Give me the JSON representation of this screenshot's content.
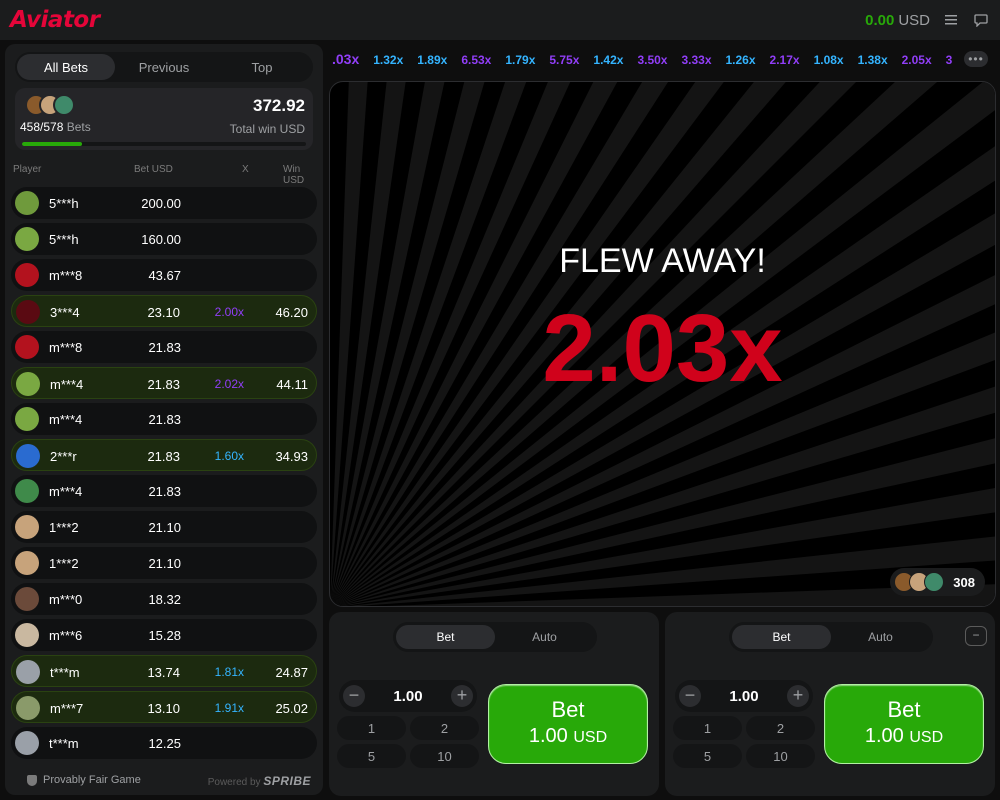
{
  "header": {
    "logo": "Aviator",
    "balance": "0.00",
    "currency": "USD"
  },
  "bets_panel": {
    "tabs": [
      "All Bets",
      "Previous",
      "Top"
    ],
    "bets_count": "458/578",
    "bets_label": "Bets",
    "total_win": "372.92",
    "total_win_label": "Total win USD",
    "progress": 0.21,
    "columns": {
      "player": "Player",
      "bet": "Bet USD",
      "x": "X",
      "win": "Win USD"
    },
    "rows": [
      {
        "player": "5***h",
        "bet": "200.00",
        "x": "",
        "win": "",
        "avatar": "#6f9a3c"
      },
      {
        "player": "5***h",
        "bet": "160.00",
        "x": "",
        "win": "",
        "avatar": "#7aa842"
      },
      {
        "player": "m***8",
        "bet": "43.67",
        "x": "",
        "win": "",
        "avatar": "#b3121e"
      },
      {
        "player": "3***4",
        "bet": "23.10",
        "x": "2.00x",
        "win": "46.20",
        "avatar": "#5a0a12"
      },
      {
        "player": "m***8",
        "bet": "21.83",
        "x": "",
        "win": "",
        "avatar": "#b3121e"
      },
      {
        "player": "m***4",
        "bet": "21.83",
        "x": "2.02x",
        "win": "44.11",
        "avatar": "#7aa842"
      },
      {
        "player": "m***4",
        "bet": "21.83",
        "x": "",
        "win": "",
        "avatar": "#7aa842"
      },
      {
        "player": "2***r",
        "bet": "21.83",
        "x": "1.60x",
        "win": "34.93",
        "avatar": "#2a6bd0"
      },
      {
        "player": "m***4",
        "bet": "21.83",
        "x": "",
        "win": "",
        "avatar": "#3f8a4a"
      },
      {
        "player": "1***2",
        "bet": "21.10",
        "x": "",
        "win": "",
        "avatar": "#c7a37b"
      },
      {
        "player": "1***2",
        "bet": "21.10",
        "x": "",
        "win": "",
        "avatar": "#c7a37b"
      },
      {
        "player": "m***0",
        "bet": "18.32",
        "x": "",
        "win": "",
        "avatar": "#6b4a3a"
      },
      {
        "player": "m***6",
        "bet": "15.28",
        "x": "",
        "win": "",
        "avatar": "#c9b8a0"
      },
      {
        "player": "t***m",
        "bet": "13.74",
        "x": "1.81x",
        "win": "24.87",
        "avatar": "#9aa0a8"
      },
      {
        "player": "m***7",
        "bet": "13.10",
        "x": "1.91x",
        "win": "25.02",
        "avatar": "#8a9a6a"
      },
      {
        "player": "t***m",
        "bet": "12.25",
        "x": "",
        "win": "",
        "avatar": "#9aa0a8"
      }
    ],
    "footer": {
      "provably_fair": "Provably Fair Game",
      "powered_by": "Powered by",
      "brand": "SPRIBE"
    }
  },
  "history": [
    {
      "v": ".03x",
      "c": "#913ef8"
    },
    {
      "v": "1.32x",
      "c": "#34b4ff"
    },
    {
      "v": "1.89x",
      "c": "#34b4ff"
    },
    {
      "v": "6.53x",
      "c": "#913ef8"
    },
    {
      "v": "1.79x",
      "c": "#34b4ff"
    },
    {
      "v": "5.75x",
      "c": "#913ef8"
    },
    {
      "v": "1.42x",
      "c": "#34b4ff"
    },
    {
      "v": "3.50x",
      "c": "#913ef8"
    },
    {
      "v": "3.33x",
      "c": "#913ef8"
    },
    {
      "v": "1.26x",
      "c": "#34b4ff"
    },
    {
      "v": "2.17x",
      "c": "#913ef8"
    },
    {
      "v": "1.08x",
      "c": "#34b4ff"
    },
    {
      "v": "1.38x",
      "c": "#34b4ff"
    },
    {
      "v": "2.05x",
      "c": "#913ef8"
    },
    {
      "v": "3",
      "c": "#913ef8"
    }
  ],
  "game": {
    "status": "FLEW AWAY!",
    "multiplier": "2.03x",
    "players_count": "308"
  },
  "bet_panels": [
    {
      "tabs": [
        "Bet",
        "Auto"
      ],
      "amount": "1.00",
      "quick": [
        "1",
        "2",
        "5",
        "10"
      ],
      "button_label": "Bet",
      "button_amount": "1.00",
      "currency": "USD"
    },
    {
      "tabs": [
        "Bet",
        "Auto"
      ],
      "amount": "1.00",
      "quick": [
        "1",
        "2",
        "5",
        "10"
      ],
      "button_label": "Bet",
      "button_amount": "1.00",
      "currency": "USD"
    }
  ],
  "colors": {
    "accent_red": "#e50539",
    "win_green": "#28a909",
    "multiplier_blue": "#34b4ff",
    "multiplier_purple": "#913ef8"
  }
}
